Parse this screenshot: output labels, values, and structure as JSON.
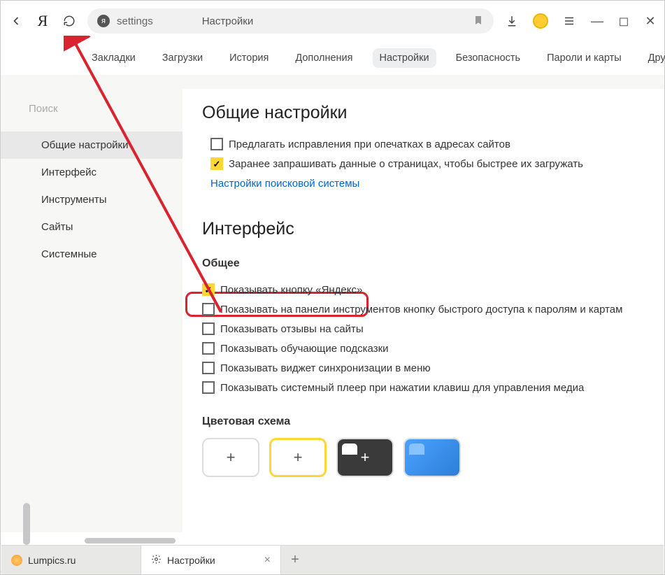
{
  "toolbar": {
    "url_text": "settings",
    "page_title": "Настройки"
  },
  "tabs": {
    "items": [
      "Закладки",
      "Загрузки",
      "История",
      "Дополнения",
      "Настройки",
      "Безопасность",
      "Пароли и карты",
      "Другие устройства"
    ],
    "active_index": 4
  },
  "sidebar": {
    "search_placeholder": "Поиск",
    "items": [
      "Общие настройки",
      "Интерфейс",
      "Инструменты",
      "Сайты",
      "Системные"
    ],
    "active_index": 0
  },
  "content": {
    "section1_title": "Общие настройки",
    "opt_suggest_typo": "Предлагать исправления при опечатках в адресах сайтов",
    "opt_prefetch": "Заранее запрашивать данные о страницах, чтобы быстрее их загружать",
    "link_search_settings": "Настройки поисковой системы",
    "section2_title": "Интерфейс",
    "sub_general": "Общее",
    "opt_yandex_btn": "Показывать кнопку «Яндекс»",
    "opt_quick_pw": "Показывать на панели инструментов кнопку быстрого доступа к паролям и картам",
    "opt_reviews": "Показывать отзывы на сайты",
    "opt_hints": "Показывать обучающие подсказки",
    "opt_sync_widget": "Показывать виджет синхронизации в меню",
    "opt_player": "Показывать системный плеер при нажатии клавиш для управления медиа",
    "sub_theme": "Цветовая схема"
  },
  "bottom_tabs": {
    "tab1": "Lumpics.ru",
    "tab2": "Настройки"
  }
}
